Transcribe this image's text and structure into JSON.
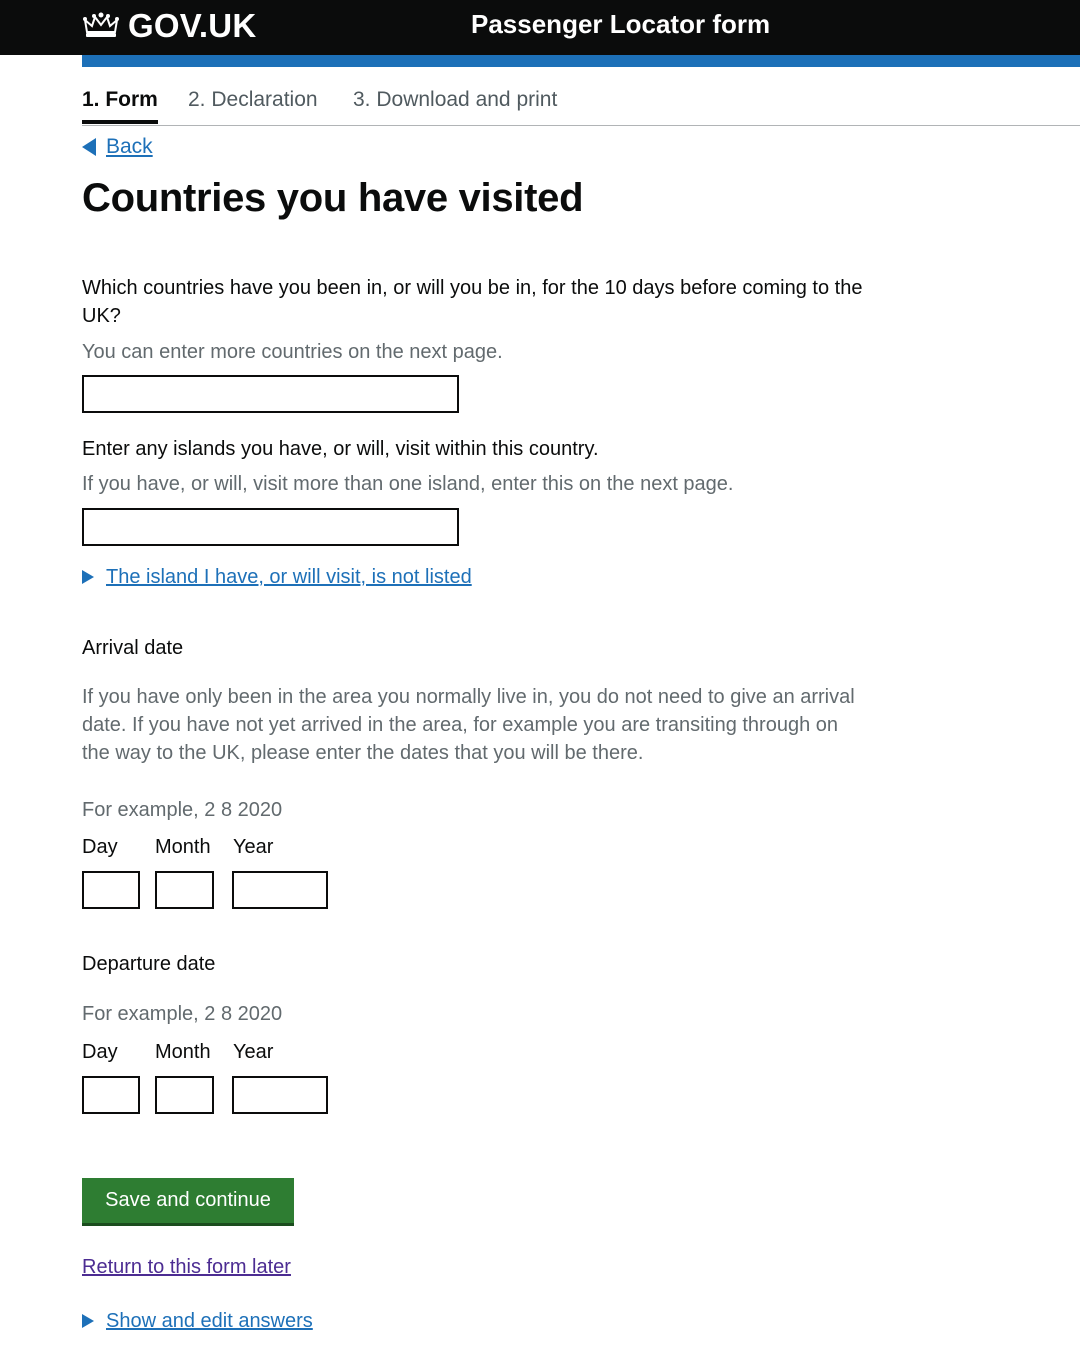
{
  "header": {
    "logo_text": "GOV.UK",
    "service_name": "Passenger Locator form"
  },
  "steps": [
    {
      "label": "1. Form",
      "active": true
    },
    {
      "label": "2. Declaration",
      "active": false
    },
    {
      "label": "3. Download and print",
      "active": false
    }
  ],
  "back_link": "Back",
  "page_title": "Countries you have visited",
  "countries": {
    "label": "Which countries have you been in, or will you be in, for the 10 days before coming to the UK?",
    "hint": "You can enter more countries on the next page.",
    "value": ""
  },
  "islands": {
    "label": "Enter any islands you have, or will, visit within this country.",
    "hint": "If you have, or will, visit more than one island, enter this on the next page.",
    "value": "",
    "details_summary": "The island I have, or will visit, is not listed"
  },
  "arrival": {
    "legend": "Arrival date",
    "hint": "If you have only been in the area you normally live in, you do not need to give an arrival date. If you have not yet arrived in the area, for example you are transiting through on the way to the UK, please enter the dates that you will be there.",
    "example": "For example, 2 8 2020",
    "day_label": "Day",
    "month_label": "Month",
    "year_label": "Year"
  },
  "departure": {
    "legend": "Departure date",
    "example": "For example, 2 8 2020",
    "day_label": "Day",
    "month_label": "Month",
    "year_label": "Year"
  },
  "actions": {
    "submit_label": "Save and continue",
    "return_link": "Return to this form later",
    "show_answers": "Show and edit answers"
  },
  "colors": {
    "header_bg": "#0b0c0c",
    "brand_blue": "#1d70b8",
    "button_green": "#2e7d32",
    "visited_link": "#4c2c92",
    "hint_grey": "#626a6e"
  },
  "icons": [
    "crown-icon",
    "back-arrow-icon",
    "disclosure-triangle-icon"
  ]
}
